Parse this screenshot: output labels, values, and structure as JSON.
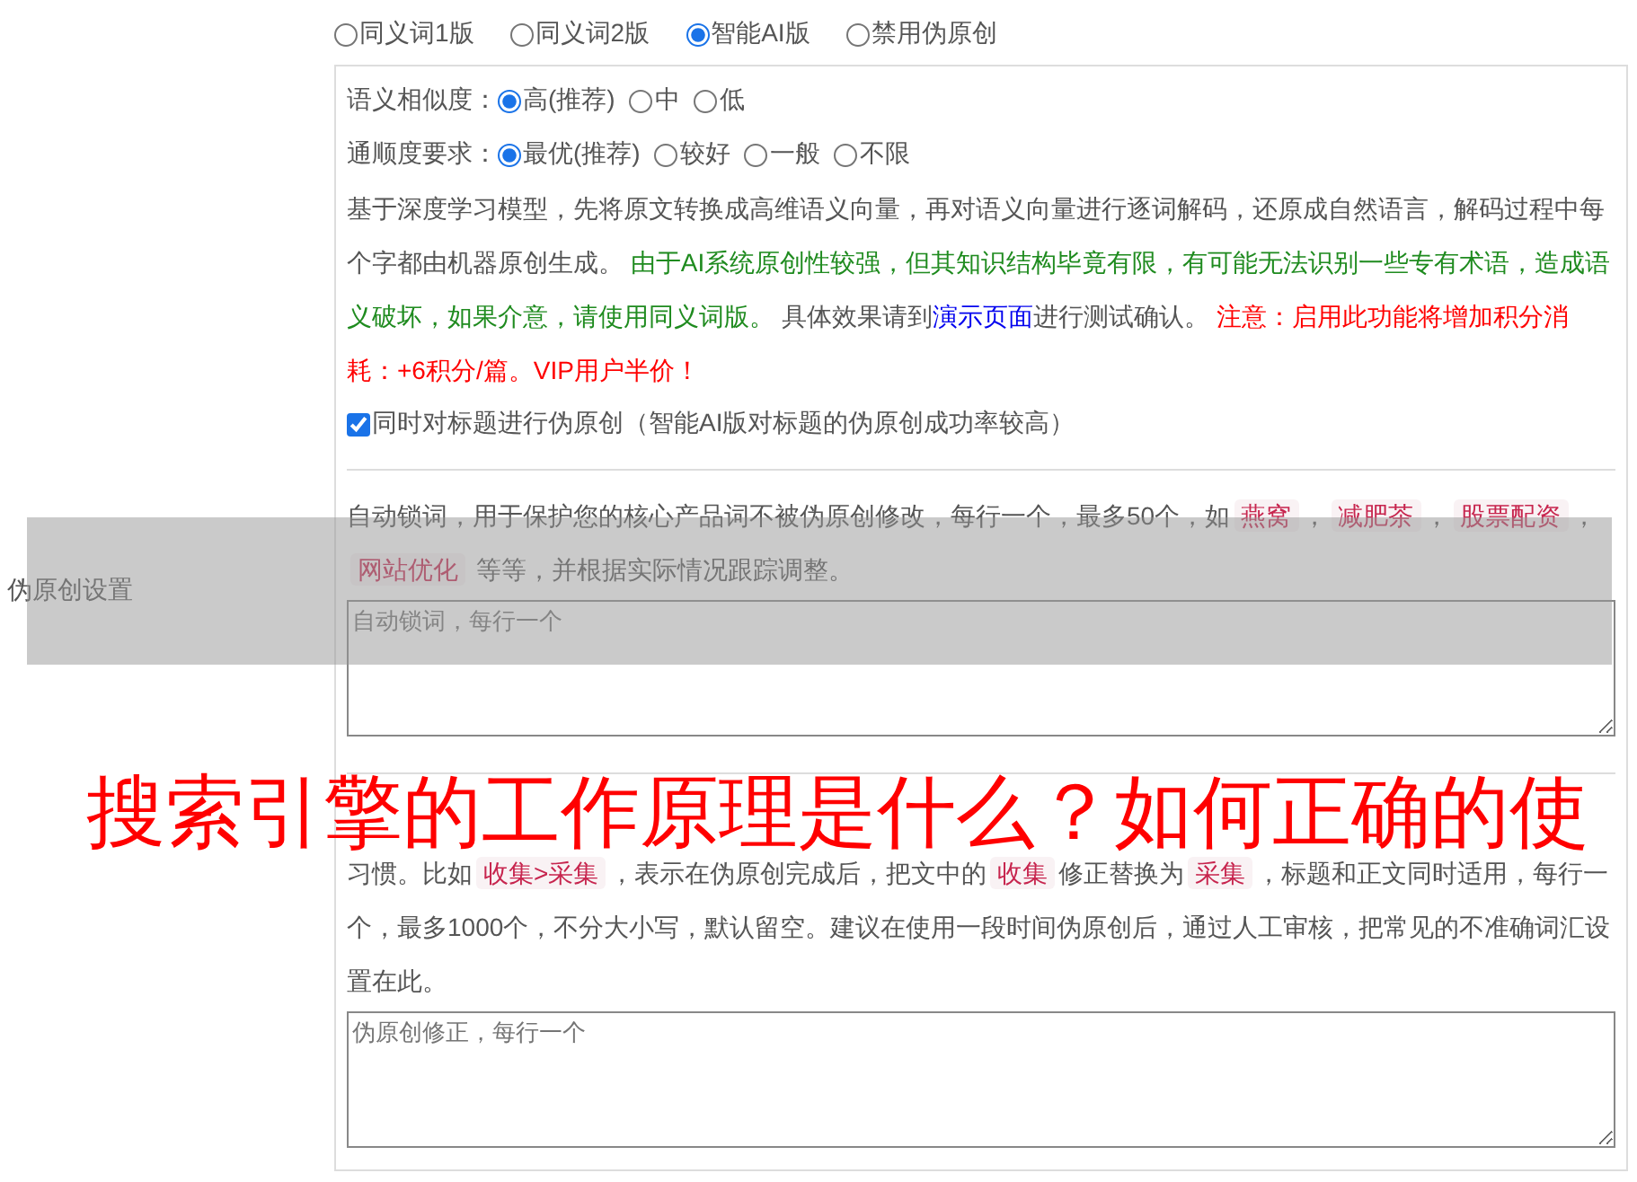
{
  "side_label": "伪原创设置",
  "modes": [
    {
      "label": "同义词1版",
      "selected": false
    },
    {
      "label": "同义词2版",
      "selected": false
    },
    {
      "label": "智能AI版",
      "selected": true
    },
    {
      "label": "禁用伪原创",
      "selected": false
    }
  ],
  "similarity": {
    "label": "语义相似度：",
    "options": [
      {
        "label": "高(推荐)",
        "selected": true
      },
      {
        "label": "中",
        "selected": false
      },
      {
        "label": "低",
        "selected": false
      }
    ]
  },
  "fluency": {
    "label": "通顺度要求：",
    "options": [
      {
        "label": "最优(推荐)",
        "selected": true
      },
      {
        "label": "较好",
        "selected": false
      },
      {
        "label": "一般",
        "selected": false
      },
      {
        "label": "不限",
        "selected": false
      }
    ]
  },
  "ai_note": [
    {
      "kind": "text",
      "text": "基于深度学习模型，先将原文转换成高维语义向量，再对语义向量进行逐词解码，还原成自然语言，解码过程中每个字都由机器原创生成。 "
    },
    {
      "kind": "notice",
      "text": "由于AI系统原创性较强，但其知识结构毕竟有限，有可能无法识别一些专有术语，造成语义破坏，如果介意，请使用同义词版。"
    },
    {
      "kind": "text",
      "text": " 具体效果请到"
    },
    {
      "kind": "link",
      "text": "演示页面"
    },
    {
      "kind": "text",
      "text": "进行测试确认。 "
    },
    {
      "kind": "warning",
      "text": "注意：启用此功能将增加积分消耗：+6积分/篇。VIP用户半价！"
    }
  ],
  "title_option": {
    "label": "同时对标题进行伪原创（智能AI版对标题的伪原创成功率较高）",
    "checked": true
  },
  "lock_words": {
    "description": [
      {
        "kind": "text",
        "text": "自动锁词，用于保护您的核心产品词不被伪原创修改，每行一个，最多50个，如"
      },
      {
        "kind": "tag",
        "text": "燕窝"
      },
      {
        "kind": "text",
        "text": "，"
      },
      {
        "kind": "tag",
        "text": "减肥茶"
      },
      {
        "kind": "text",
        "text": "，"
      },
      {
        "kind": "tag",
        "text": "股票配资"
      },
      {
        "kind": "text",
        "text": "，"
      },
      {
        "kind": "tag",
        "text": "网站优化"
      },
      {
        "kind": "text",
        "text": " 等等，并根据实际情况跟踪调整。"
      }
    ],
    "placeholder": "自动锁词，每行一个"
  },
  "correction": {
    "description": [
      {
        "kind": "text",
        "text": "习惯。比如"
      },
      {
        "kind": "tag",
        "text": "收集>采集"
      },
      {
        "kind": "text",
        "text": "，表示在伪原创完成后，把文中的"
      },
      {
        "kind": "tag",
        "text": "收集"
      },
      {
        "kind": "text",
        "text": "修正替换为"
      },
      {
        "kind": "tag",
        "text": "采集"
      },
      {
        "kind": "text",
        "text": "，标题和正文同时适用，每行一个，最多1000个，不分大小写，默认留空。建议在使用一段时间伪原创后，通过人工审核，把常见的不准确词汇设置在此。"
      }
    ],
    "placeholder": "伪原创修正，每行一个"
  },
  "overlay": {
    "title": "搜索引擎的工作原理是什么？如何正确的使"
  }
}
